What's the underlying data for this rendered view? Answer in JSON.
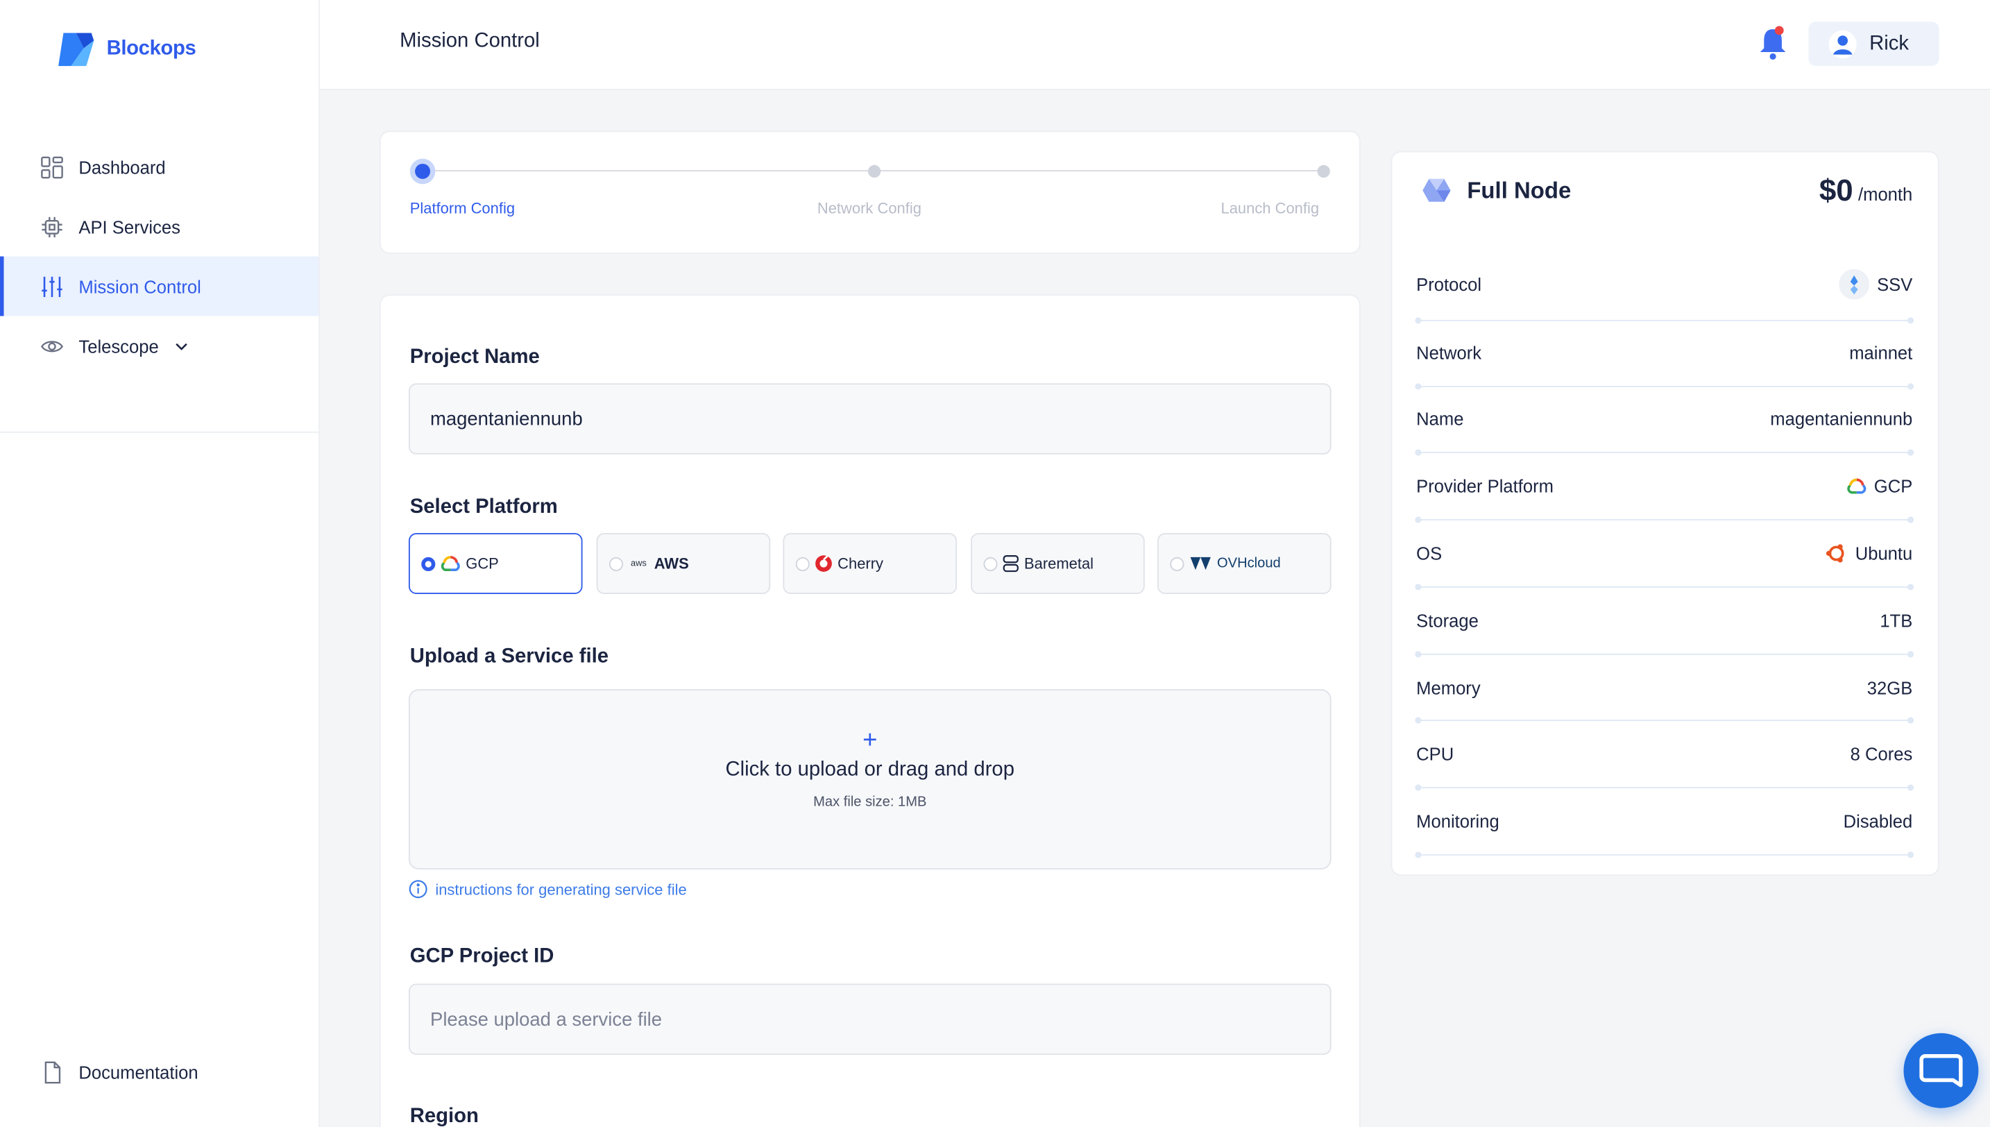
{
  "brand": {
    "name": "Blockops"
  },
  "sidebar": {
    "items": [
      {
        "label": "Dashboard"
      },
      {
        "label": "API Services"
      },
      {
        "label": "Mission Control"
      },
      {
        "label": "Telescope"
      }
    ],
    "footer_label": "Documentation"
  },
  "header": {
    "title": "Mission Control",
    "user_name": "Rick"
  },
  "stepper": {
    "steps": [
      {
        "label": "Platform Config",
        "state": "active"
      },
      {
        "label": "Network Config",
        "state": "pending"
      },
      {
        "label": "Launch Config",
        "state": "pending"
      }
    ]
  },
  "form": {
    "project_name_label": "Project Name",
    "project_name_value": "magentaniennunb",
    "platform_label": "Select Platform",
    "platforms": [
      {
        "label": "GCP",
        "selected": true
      },
      {
        "label": "AWS",
        "selected": false
      },
      {
        "label": "Cherry",
        "selected": false
      },
      {
        "label": "Baremetal",
        "selected": false
      },
      {
        "label": "OVHcloud",
        "selected": false
      }
    ],
    "aws_logo_text": "aws",
    "upload_label": "Upload a Service file",
    "upload_icon": "+",
    "upload_text": "Click to upload or drag and drop",
    "upload_hint": "Max file size: 1MB",
    "instructions_link": "instructions for generating service file",
    "project_id_label": "GCP Project ID",
    "project_id_placeholder": "Please upload a service file",
    "region_label": "Region"
  },
  "summary": {
    "title": "Full Node",
    "price": "$0",
    "period": "/month",
    "rows": [
      {
        "label": "Protocol",
        "value": "SSV",
        "icon": "ssv-icon"
      },
      {
        "label": "Network",
        "value": "mainnet"
      },
      {
        "label": "Name",
        "value": "magentaniennunb"
      },
      {
        "label": "Provider Platform",
        "value": "GCP",
        "icon": "gcp-icon"
      },
      {
        "label": "OS",
        "value": "Ubuntu",
        "icon": "ubuntu-icon"
      },
      {
        "label": "Storage",
        "value": "1TB"
      },
      {
        "label": "Memory",
        "value": "32GB"
      },
      {
        "label": "CPU",
        "value": "8 Cores"
      },
      {
        "label": "Monitoring",
        "value": "Disabled"
      }
    ]
  },
  "colors": {
    "accent": "#2f5bea",
    "bell": "#3d6cf0",
    "bell_badge": "#ef4444",
    "chat": "#1f6fe0"
  }
}
